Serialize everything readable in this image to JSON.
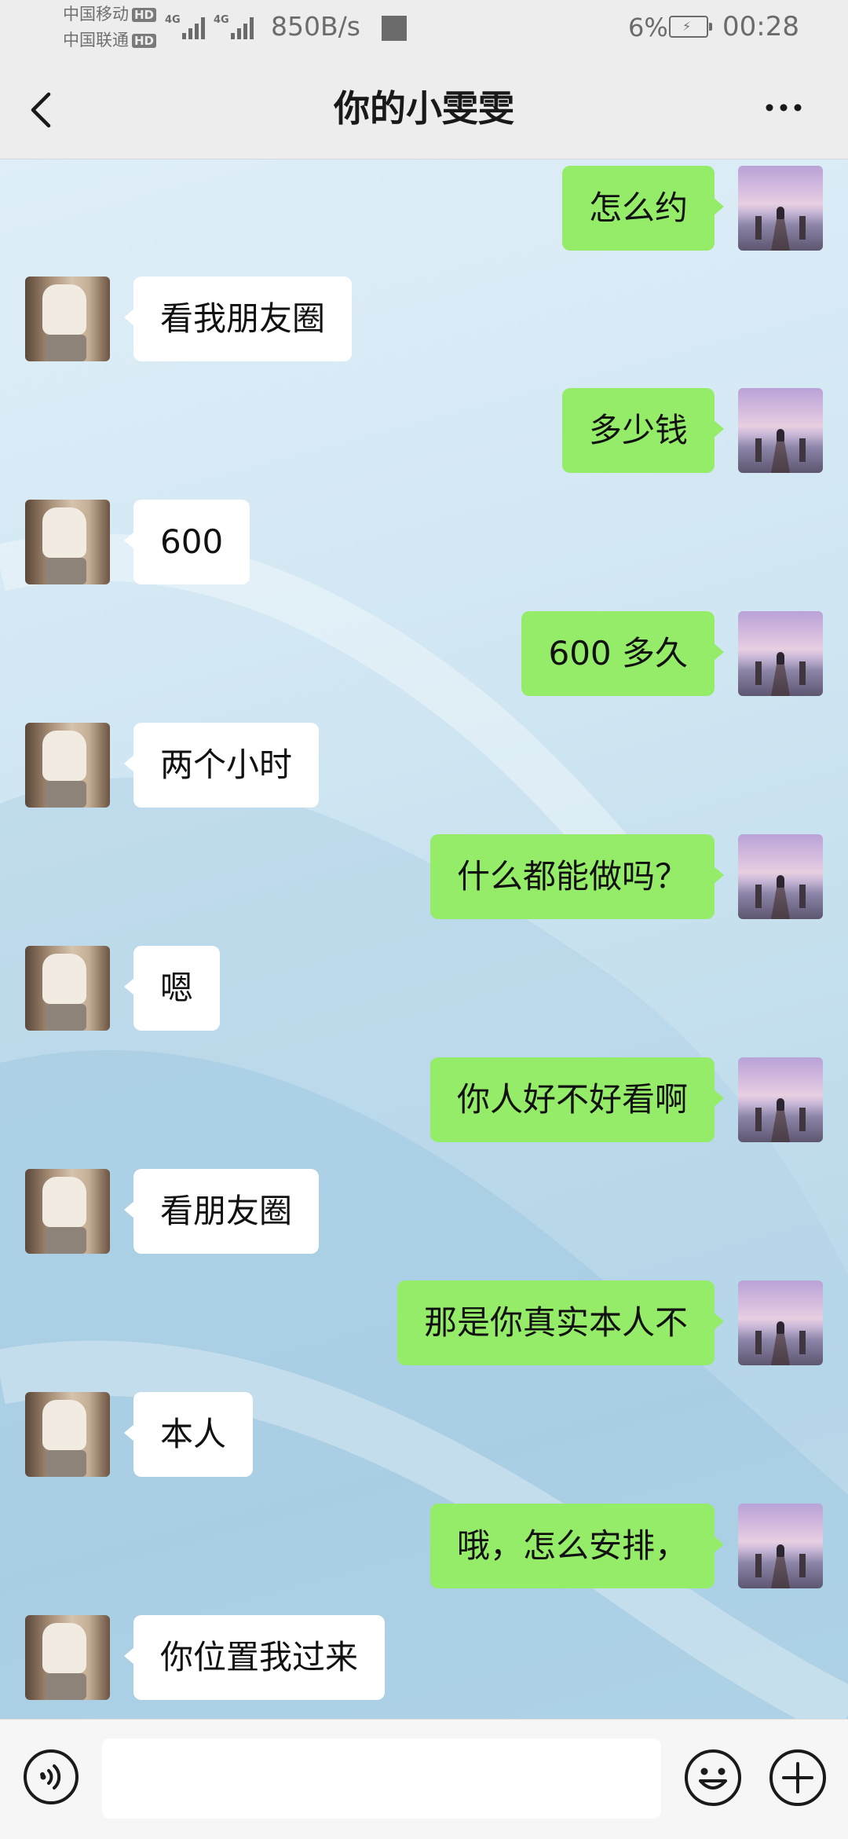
{
  "status_bar": {
    "carrier1": "中国移动",
    "carrier2": "中国联通",
    "hd_badge": "HD",
    "network_type": "4G",
    "net_speed": "850B/s",
    "battery_percent": "6%",
    "time": "00:28"
  },
  "header": {
    "title": "你的小雯雯",
    "back_icon": "chevron-left-icon",
    "more_icon": "ellipsis-icon"
  },
  "messages": [
    {
      "direction": "out",
      "text": "怎么约"
    },
    {
      "direction": "in",
      "text": "看我朋友圈"
    },
    {
      "direction": "out",
      "text": "多少钱"
    },
    {
      "direction": "in",
      "text": "600"
    },
    {
      "direction": "out",
      "text": "600 多久"
    },
    {
      "direction": "in",
      "text": "两个小时"
    },
    {
      "direction": "out",
      "text": "什么都能做吗？"
    },
    {
      "direction": "in",
      "text": "嗯"
    },
    {
      "direction": "out",
      "text": "你人好不好看啊"
    },
    {
      "direction": "in",
      "text": "看朋友圈"
    },
    {
      "direction": "out",
      "text": "那是你真实本人不"
    },
    {
      "direction": "in",
      "text": "本人"
    },
    {
      "direction": "out",
      "text": "哦，怎么安排，"
    },
    {
      "direction": "in",
      "text": "你位置我过来"
    }
  ],
  "input_bar": {
    "text_value": "",
    "voice_icon": "voice-icon",
    "emoji_icon": "emoji-icon",
    "plus_icon": "plus-icon"
  },
  "colors": {
    "outgoing_bubble": "#95ec69",
    "incoming_bubble": "#ffffff",
    "bar_background": "#ededed"
  }
}
